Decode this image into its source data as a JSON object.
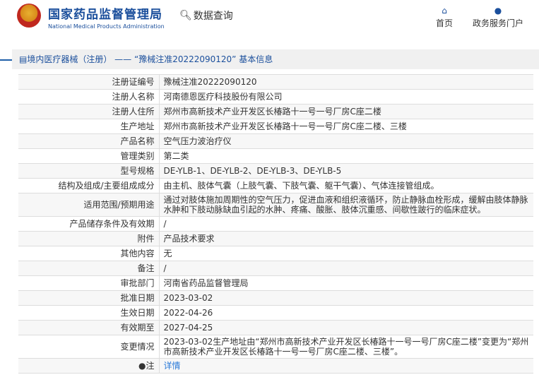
{
  "header": {
    "org_cn": "国家药品监督管理局",
    "org_en": "National Medical Products Administration",
    "data_query": "数据查询",
    "nav": [
      {
        "label": "首页",
        "icon": "home-icon"
      },
      {
        "label": "政务服务门户",
        "icon": "user-icon"
      }
    ]
  },
  "panel": {
    "title": "境内医疗器械（注册） —— “豫械注准20222090120” 基本信息"
  },
  "rows": [
    {
      "label": "注册证编号",
      "value": "豫械注准20222090120"
    },
    {
      "label": "注册人名称",
      "value": "河南德恩医疗科技股份有限公司"
    },
    {
      "label": "注册人住所",
      "value": "郑州市高新技术产业开发区长椿路十一号一号厂房C座二楼"
    },
    {
      "label": "生产地址",
      "value": "郑州市高新技术产业开发区长椿路十一号一号厂房C座二楼、三楼"
    },
    {
      "label": "产品名称",
      "value": "空气压力波治疗仪"
    },
    {
      "label": "管理类别",
      "value": "第二类"
    },
    {
      "label": "型号规格",
      "value": "DE-YLB-1、DE-YLB-2、DE-YLB-3、DE-YLB-5"
    },
    {
      "label": "结构及组成/主要组成成分",
      "value": "由主机、肢体气囊（上肢气囊、下肢气囊、躯干气囊）、气体连接管组成。"
    },
    {
      "label": "适用范围/预期用途",
      "value": "通过对肢体施加周期性的空气压力，促进血液和组织液循环，防止静脉血栓形成，缓解由肢体静脉水肿和下肢动脉缺血引起的水肿、疼痛、酸胀、肢体沉重感、间歇性跛行的临床症状。"
    },
    {
      "label": "产品储存条件及有效期",
      "value": "/"
    },
    {
      "label": "附件",
      "value": "产品技术要求"
    },
    {
      "label": "其他内容",
      "value": "无"
    },
    {
      "label": "备注",
      "value": "/"
    },
    {
      "label": "审批部门",
      "value": "河南省药品监督管理局"
    },
    {
      "label": "批准日期",
      "value": "2023-03-02"
    },
    {
      "label": "生效日期",
      "value": "2022-04-26"
    },
    {
      "label": "有效期至",
      "value": "2027-04-25"
    },
    {
      "label": "变更情况",
      "value": "2023-03-02生产地址由“郑州市高新技术产业开发区长椿路十一号一号厂房C座二楼”变更为“郑州市高新技术产业开发区长椿路十一号一号厂房C座二楼、三楼”。"
    }
  ],
  "note": {
    "label": "注",
    "link": "详情"
  }
}
